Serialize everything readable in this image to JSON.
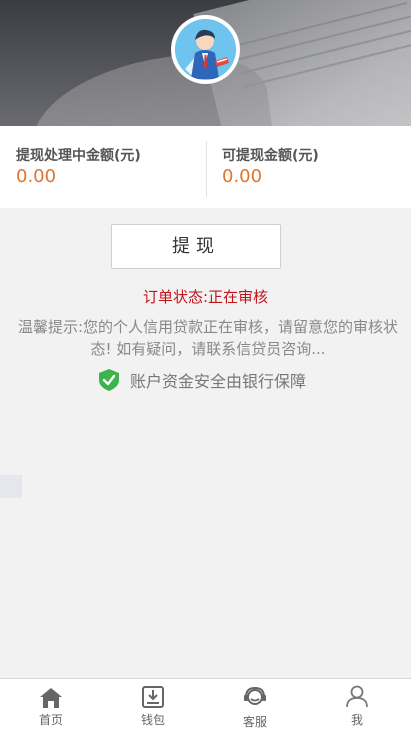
{
  "balances": {
    "processing_label": "提现处理中金额(元)",
    "processing_value": "0.00",
    "available_label": "可提现金额(元)",
    "available_value": "0.00"
  },
  "actions": {
    "withdraw_label": "提现"
  },
  "status": {
    "order_status": "订单状态:正在审核",
    "tip": "温馨提示:您的个人信用贷款正在审核，请留意您的审核状态! 如有疑问，请联系信贷员咨询...",
    "security_text": "账户资金安全由银行保障"
  },
  "tabbar": {
    "items": [
      {
        "label": "首页",
        "icon": "home-icon"
      },
      {
        "label": "钱包",
        "icon": "wallet-download-icon"
      },
      {
        "label": "客服",
        "icon": "customer-service-icon"
      },
      {
        "label": "我",
        "icon": "user-icon"
      }
    ]
  },
  "colors": {
    "amount": "#e0762c",
    "status": "#c0141c",
    "shield": "#3cb44a"
  }
}
